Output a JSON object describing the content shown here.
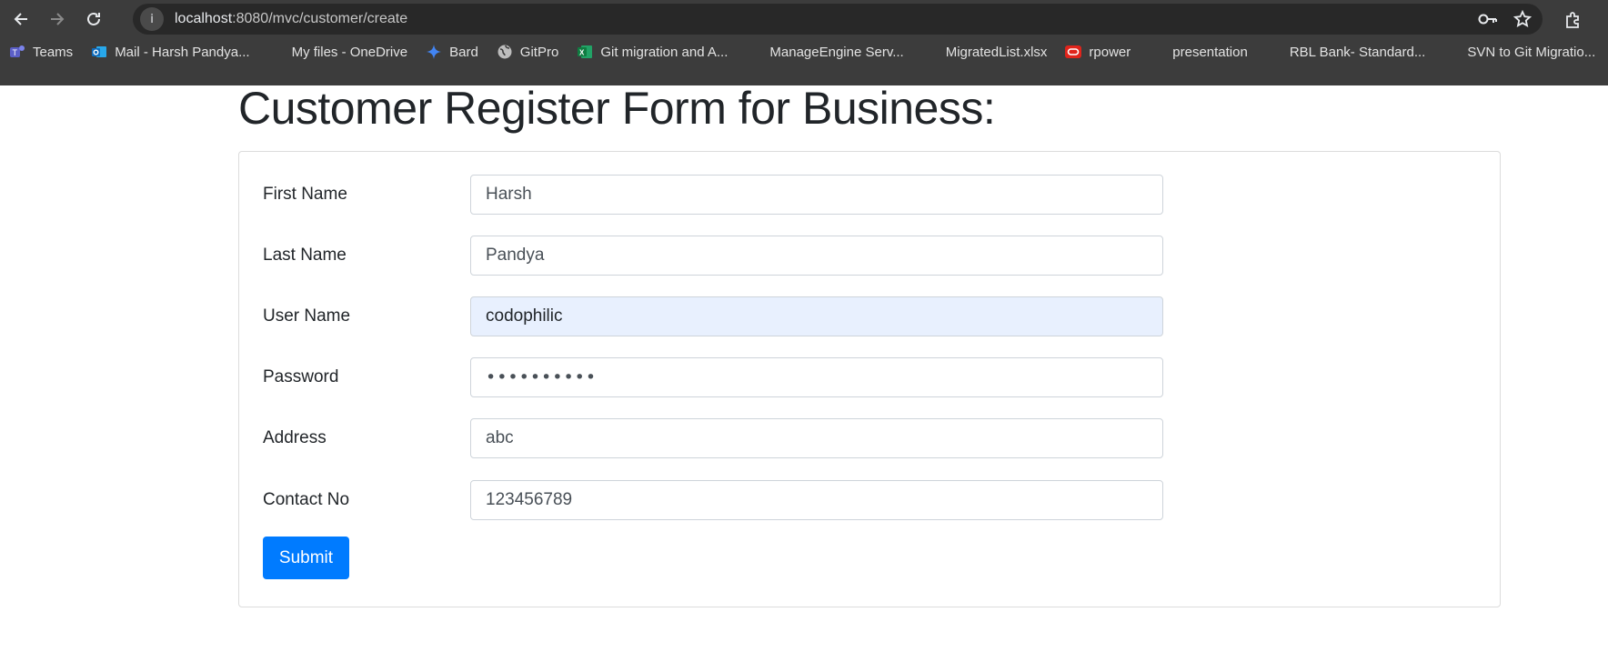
{
  "browser": {
    "url_host": "localhost",
    "url_path": ":8080/mvc/customer/create",
    "icons": [
      "back-icon",
      "forward-icon",
      "reload-icon",
      "site-info-icon",
      "key-icon",
      "star-icon",
      "extensions-icon"
    ]
  },
  "bookmarks": [
    {
      "label": "Teams",
      "icon": "teams-icon",
      "color": "#5b5fc7"
    },
    {
      "label": "Mail - Harsh Pandya...",
      "icon": "outlook-icon",
      "color": "#0f6cbd"
    },
    {
      "label": "My files - OneDrive",
      "icon": "microsoft-icon"
    },
    {
      "label": "Bard",
      "icon": "bard-sparkle-icon",
      "color": "#4285f4"
    },
    {
      "label": "GitPro",
      "icon": "globe-icon"
    },
    {
      "label": "Git migration and A...",
      "icon": "excel-icon",
      "color": "#107c41"
    },
    {
      "label": "ManageEngine Serv...",
      "icon": "microsoft-icon"
    },
    {
      "label": "MigratedList.xlsx",
      "icon": "microsoft-icon"
    },
    {
      "label": "rpower",
      "icon": "oracle-icon",
      "color": "#e0241b"
    },
    {
      "label": "presentation",
      "icon": "microsoft-icon"
    },
    {
      "label": "RBL Bank- Standard...",
      "icon": "microsoft-icon"
    },
    {
      "label": "SVN to Git Migratio...",
      "icon": "microsoft-icon"
    }
  ],
  "page": {
    "title": "Customer Register Form for Business:"
  },
  "form": {
    "first_name": {
      "label": "First Name",
      "value": "Harsh"
    },
    "last_name": {
      "label": "Last Name",
      "value": "Pandya"
    },
    "user_name": {
      "label": "User Name",
      "value": "codophilic"
    },
    "password": {
      "label": "Password",
      "value": "••••••••••"
    },
    "address": {
      "label": "Address",
      "value": "abc"
    },
    "contact_no": {
      "label": "Contact No",
      "value": "123456789"
    },
    "submit_label": "Submit"
  },
  "colors": {
    "primary": "#007bff",
    "autofill_bg": "#e8f0fe",
    "chrome_bg": "#3c3c3c"
  }
}
